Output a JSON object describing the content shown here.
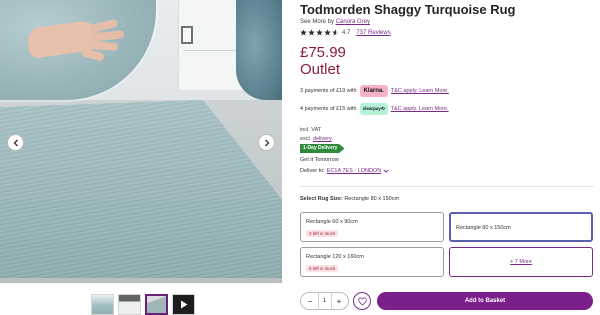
{
  "product": {
    "title": "Todmorden Shaggy Turquoise Rug",
    "see_more_prefix": "See More by",
    "brand": "Canora Grey",
    "rating": "4.7",
    "reviews_link": "737 Reviews",
    "price": "£75.99",
    "badge": "Outlet"
  },
  "payments": {
    "klarna": {
      "text": "3 payments of £19 with",
      "badge": "Klarna.",
      "link": "T&C apply. Learn More."
    },
    "clearpay": {
      "text": "4 payments of £15 with",
      "badge": "clearpay⟲",
      "link": "T&C apply. Learn More."
    }
  },
  "delivery": {
    "vat": "incl. VAT",
    "excl_prefix": "excl.",
    "excl_link": "delivery",
    "one_day_badge": "1-Day Delivery",
    "get_it": "Get it Tomorrow",
    "deliver_to_prefix": "Deliver to:",
    "deliver_to_link": "EC1A 7ES - LONDON"
  },
  "size": {
    "label": "Select Rug Size:",
    "selected": "Rectangle 80 x 150cm",
    "options": [
      {
        "name": "Rectangle 60 x 90cm",
        "stock": "3 left in stock"
      },
      {
        "name": "Rectangle 80 x 150cm",
        "stock": ""
      },
      {
        "name": "Rectangle 120 x 160cm",
        "stock": "8 left in stock"
      }
    ],
    "more": "+ 7 More"
  },
  "cart": {
    "qty_minus": "−",
    "quantity": "1",
    "qty_plus": "+",
    "add_to_basket": "Add to Basket"
  },
  "colors": {
    "accent": "#7b1f8a",
    "price": "#8b1d3c",
    "delivery_badge": "#2f8a3a"
  }
}
